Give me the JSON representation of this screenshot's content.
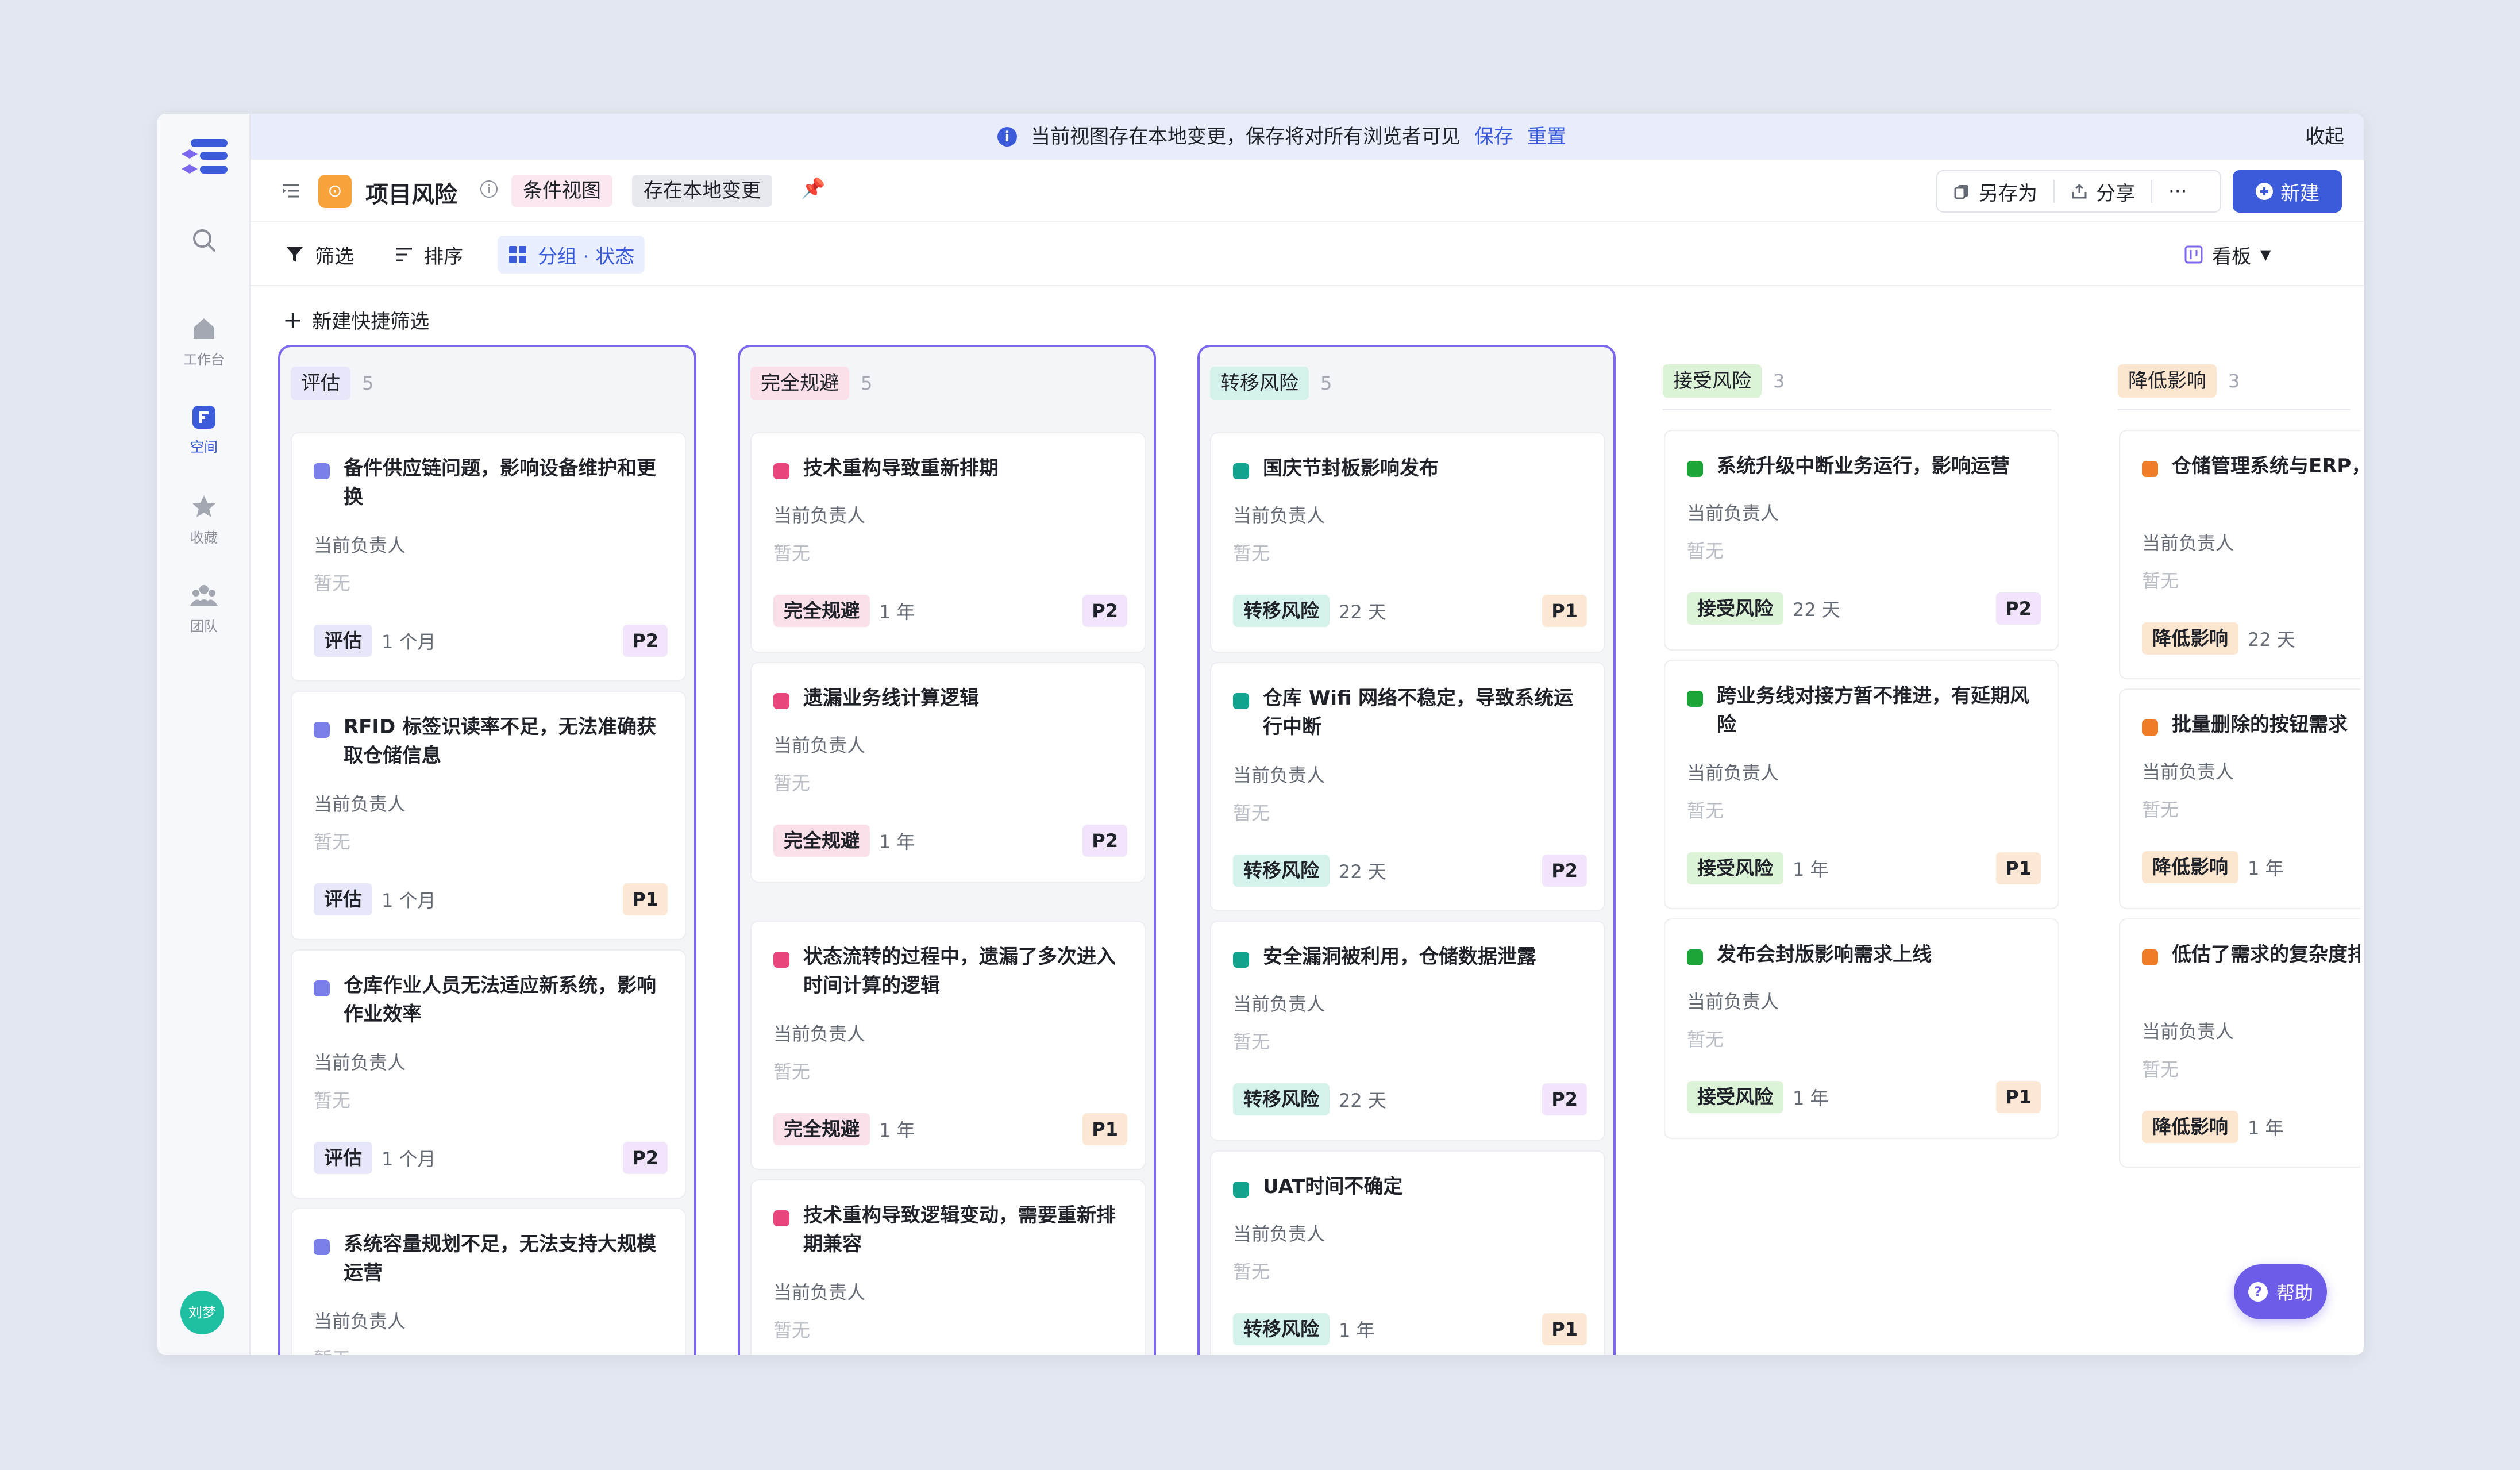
{
  "banner": {
    "message": "当前视图存在本地变更，保存将对所有浏览者可见",
    "save": "保存",
    "reset": "重置",
    "collapse": "收起"
  },
  "rail": {
    "items": [
      {
        "label": ""
      },
      {
        "label": "工作台"
      },
      {
        "label": "空间"
      },
      {
        "label": "收藏"
      },
      {
        "label": "团队"
      }
    ],
    "avatar": "刘梦"
  },
  "header": {
    "title": "项目风险",
    "tag_condition": "条件视图",
    "tag_local": "存在本地变更",
    "save_as": "另存为",
    "share": "分享",
    "more": "···",
    "new": "新建"
  },
  "toolbar": {
    "filter": "筛选",
    "sort": "排序",
    "group": "分组 · 状态",
    "view": "看板"
  },
  "quick_filter": "新建快捷筛选",
  "owner_label": "当前负责人",
  "owner_empty": "暂无",
  "help": "帮助",
  "colors": {
    "accent": "#3b5bdb",
    "frame": "#7b68ee"
  },
  "columns": [
    {
      "name": "评估",
      "count": "5",
      "tag_bg": "#e6e8fa",
      "dot": "#7b80e8",
      "cards": [
        {
          "title": "备件供应链问题，影响设备维护和更换",
          "status": "评估",
          "duration": "1 个月",
          "priority": "P2"
        },
        {
          "title": "RFID 标签识读率不足，无法准确获取仓储信息",
          "status": "评估",
          "duration": "1 个月",
          "priority": "P1"
        },
        {
          "title": "仓库作业人员无法适应新系统，影响作业效率",
          "status": "评估",
          "duration": "1 个月",
          "priority": "P2"
        },
        {
          "title": "系统容量规划不足，无法支持大规模运营",
          "status": "",
          "duration": "",
          "priority": ""
        }
      ]
    },
    {
      "name": "完全规避",
      "count": "5",
      "tag_bg": "#fbe0ea",
      "dot": "#e8457d",
      "cards": [
        {
          "title": "技术重构导致重新排期",
          "status": "完全规避",
          "duration": "1 年",
          "priority": "P2"
        },
        {
          "title": "遗漏业务线计算逻辑",
          "status": "完全规避",
          "duration": "1 年",
          "priority": "P2"
        },
        {
          "title": "状态流转的过程中，遗漏了多次进入时间计算的逻辑",
          "status": "完全规避",
          "duration": "1 年",
          "priority": "P1"
        },
        {
          "title": "技术重构导致逻辑变动，需要重新排期兼容",
          "status": "",
          "duration": "",
          "priority": ""
        }
      ]
    },
    {
      "name": "转移风险",
      "count": "5",
      "tag_bg": "#d4f1ec",
      "dot": "#12a38e",
      "cards": [
        {
          "title": "国庆节封板影响发布",
          "status": "转移风险",
          "duration": "22 天",
          "priority": "P1"
        },
        {
          "title": "仓库 Wifi 网络不稳定，导致系统运行中断",
          "status": "转移风险",
          "duration": "22 天",
          "priority": "P2"
        },
        {
          "title": "安全漏洞被利用，仓储数据泄露",
          "status": "转移风险",
          "duration": "22 天",
          "priority": "P2"
        },
        {
          "title": "UAT时间不确定",
          "status": "转移风险",
          "duration": "1 年",
          "priority": "P1"
        }
      ]
    },
    {
      "name": "接受风险",
      "count": "3",
      "tag_bg": "#dcf3d8",
      "dot": "#1ea53a",
      "cards": [
        {
          "title": "系统升级中断业务运行，影响运营",
          "status": "接受风险",
          "duration": "22 天",
          "priority": "P2"
        },
        {
          "title": "跨业务线对接方暂不推进，有延期风险",
          "status": "接受风险",
          "duration": "1 年",
          "priority": "P1"
        },
        {
          "title": "发布会封版影响需求上线",
          "status": "接受风险",
          "duration": "1 年",
          "priority": "P1"
        }
      ]
    },
    {
      "name": "降低影响",
      "count": "3",
      "tag_bg": "#fde6cf",
      "dot": "#ef7c26",
      "cards": [
        {
          "title": "仓储管理系统与ERP，无法实现数据同步",
          "status": "降低影响",
          "duration": "22 天",
          "priority": ""
        },
        {
          "title": "批量删除的按钮需求",
          "status": "降低影响",
          "duration": "1 年",
          "priority": ""
        },
        {
          "title": "低估了需求的复杂度排期",
          "status": "降低影响",
          "duration": "1 年",
          "priority": ""
        }
      ]
    }
  ]
}
